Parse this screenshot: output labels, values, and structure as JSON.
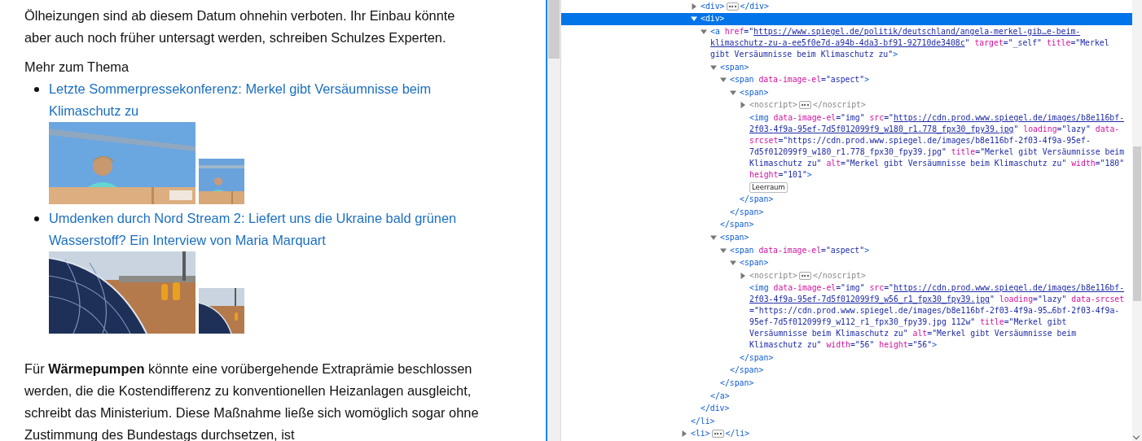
{
  "article": {
    "paragraphs_top": [
      "Ölheizungen sind ab diesem Datum ohnehin verboten. Ihr Einbau könnte aber auch noch früher untersagt werden, schreiben Schulzes Experten."
    ],
    "related": {
      "heading": "Mehr zum Thema",
      "items": [
        {
          "title": "Letzte Sommerpressekonferenz: Merkel gibt Versäumnisse beim Klimaschutz zu"
        },
        {
          "title": "Umdenken durch Nord Stream 2: Liefert uns die Ukraine bald grünen Wasserstoff? Ein Interview von Maria Marquart"
        }
      ]
    },
    "paragraphs_bottom": [
      "Für **Wärmepumpen** könnte eine vorübergehende Extraprämie beschlossen werden, die die Kostendifferenz zu konventionellen Heizanlagen ausgleicht, schreibt das Ministerium. Diese Maßnahme ließe sich womöglich sogar ohne Zustimmung des Bundestags durchsetzen, ist"
    ]
  },
  "inspector": {
    "tree": [
      {
        "kind": "element",
        "expanded": true,
        "selected": false,
        "close": [
          {
            "kind": "tag",
            "text": "</li>"
          }
        ],
        "children": [
          {
            "kind": "element",
            "expanded": false,
            "selected": false,
            "open": [
              {
                "kind": "tag",
                "text": "<div>"
              }
            ],
            "close": [
              {
                "kind": "tag",
                "text": "</div>"
              }
            ]
          },
          {
            "kind": "element",
            "expanded": true,
            "selected": true,
            "open": [
              {
                "kind": "tag",
                "text": "<div>"
              }
            ],
            "close": [
              {
                "kind": "tag",
                "text": "</div>"
              }
            ],
            "children": [
              {
                "kind": "element",
                "expanded": true,
                "selected": false,
                "open": [
                  {
                    "kind": "tag",
                    "text": "<a"
                  },
                  {
                    "kind": "attr",
                    "text": " href"
                  },
                  {
                    "kind": "value",
                    "text": "=\""
                  },
                  {
                    "kind": "link",
                    "text": "https://www.spiegel.de/politik/deutschland/angela-merkel-gib…e-beim-klimaschutz-zu-a-ee5f0e7d-a94b-4da3-bf91-92710de3408c"
                  },
                  {
                    "kind": "value",
                    "text": "\""
                  },
                  {
                    "kind": "attr",
                    "text": " target"
                  },
                  {
                    "kind": "value",
                    "text": "=\"_self\""
                  },
                  {
                    "kind": "attr",
                    "text": " title"
                  },
                  {
                    "kind": "value",
                    "text": "=\"Merkel gibt Versäumnisse beim Klimaschutz zu\""
                  },
                  {
                    "kind": "tag",
                    "text": ">"
                  }
                ],
                "close": [
                  {
                    "kind": "tag",
                    "text": "</a>"
                  }
                ],
                "children": [
                  {
                    "kind": "element",
                    "expanded": true,
                    "selected": false,
                    "open": [
                      {
                        "kind": "tag",
                        "text": "<span>"
                      }
                    ],
                    "close": [
                      {
                        "kind": "tag",
                        "text": "</span>"
                      }
                    ],
                    "children": [
                      {
                        "kind": "element",
                        "expanded": true,
                        "selected": false,
                        "open": [
                          {
                            "kind": "tag",
                            "text": "<span"
                          },
                          {
                            "kind": "attr",
                            "text": " data-image-el"
                          },
                          {
                            "kind": "value",
                            "text": "=\"aspect\""
                          },
                          {
                            "kind": "tag",
                            "text": ">"
                          }
                        ],
                        "close": [
                          {
                            "kind": "tag",
                            "text": "</span>"
                          }
                        ],
                        "children": [
                          {
                            "kind": "element",
                            "expanded": true,
                            "selected": false,
                            "open": [
                              {
                                "kind": "tag",
                                "text": "<span>"
                              }
                            ],
                            "close": [
                              {
                                "kind": "tag",
                                "text": "</span>"
                              }
                            ],
                            "children": [
                              {
                                "kind": "element",
                                "expanded": false,
                                "selected": false,
                                "open": [
                                  {
                                    "kind": "dim",
                                    "text": "<noscript>"
                                  }
                                ],
                                "close": [
                                  {
                                    "kind": "dim",
                                    "text": "</noscript>"
                                  }
                                ]
                              },
                              {
                                "kind": "leaf",
                                "selected": false,
                                "open": [
                                  {
                                    "kind": "tag",
                                    "text": "<img"
                                  },
                                  {
                                    "kind": "attr",
                                    "text": " data-image-el"
                                  },
                                  {
                                    "kind": "value",
                                    "text": "=\"img\""
                                  },
                                  {
                                    "kind": "attr",
                                    "text": " src"
                                  },
                                  {
                                    "kind": "value",
                                    "text": "=\""
                                  },
                                  {
                                    "kind": "link",
                                    "text": "https://cdn.prod.www.spiegel.de/images/b8e116bf-2f03-4f9a-95ef-7d5f012099f9_w180_r1.778_fpx30_fpy39.jpg"
                                  },
                                  {
                                    "kind": "value",
                                    "text": "\""
                                  },
                                  {
                                    "kind": "attr",
                                    "text": " loading"
                                  },
                                  {
                                    "kind": "value",
                                    "text": "=\"lazy\""
                                  },
                                  {
                                    "kind": "attr",
                                    "text": " data-srcset"
                                  },
                                  {
                                    "kind": "value",
                                    "text": "=\"https://cdn.prod.www.spiegel.de/images/b8e116bf-2f03-4f9a-95ef-7d5f012099f9_w180_r1.778_fpx30_fpy39.jpg\""
                                  },
                                  {
                                    "kind": "attr",
                                    "text": " title"
                                  },
                                  {
                                    "kind": "value",
                                    "text": "=\"Merkel gibt Versäumnisse beim Klimaschutz zu\""
                                  },
                                  {
                                    "kind": "attr",
                                    "text": " alt"
                                  },
                                  {
                                    "kind": "value",
                                    "text": "=\"Merkel gibt Versäumnisse beim Klimaschutz zu\""
                                  },
                                  {
                                    "kind": "attr",
                                    "text": " width"
                                  },
                                  {
                                    "kind": "value",
                                    "text": "=\"180\""
                                  },
                                  {
                                    "kind": "attr",
                                    "text": " height"
                                  },
                                  {
                                    "kind": "value",
                                    "text": "=\"101\""
                                  },
                                  {
                                    "kind": "tag",
                                    "text": ">"
                                  }
                                ]
                              },
                              {
                                "kind": "whitespace",
                                "selected": false,
                                "label": "Leerraum"
                              }
                            ]
                          }
                        ]
                      }
                    ]
                  },
                  {
                    "kind": "element",
                    "expanded": true,
                    "selected": false,
                    "open": [
                      {
                        "kind": "tag",
                        "text": "<span>"
                      }
                    ],
                    "close": [
                      {
                        "kind": "tag",
                        "text": "</span>"
                      }
                    ],
                    "children": [
                      {
                        "kind": "element",
                        "expanded": true,
                        "selected": false,
                        "open": [
                          {
                            "kind": "tag",
                            "text": "<span"
                          },
                          {
                            "kind": "attr",
                            "text": " data-image-el"
                          },
                          {
                            "kind": "value",
                            "text": "=\"aspect\""
                          },
                          {
                            "kind": "tag",
                            "text": ">"
                          }
                        ],
                        "close": [
                          {
                            "kind": "tag",
                            "text": "</span>"
                          }
                        ],
                        "children": [
                          {
                            "kind": "element",
                            "expanded": true,
                            "selected": false,
                            "open": [
                              {
                                "kind": "tag",
                                "text": "<span>"
                              }
                            ],
                            "close": [
                              {
                                "kind": "tag",
                                "text": "</span>"
                              }
                            ],
                            "children": [
                              {
                                "kind": "element",
                                "expanded": false,
                                "selected": false,
                                "open": [
                                  {
                                    "kind": "dim",
                                    "text": "<noscript>"
                                  }
                                ],
                                "close": [
                                  {
                                    "kind": "dim",
                                    "text": "</noscript>"
                                  }
                                ]
                              },
                              {
                                "kind": "leaf",
                                "selected": false,
                                "open": [
                                  {
                                    "kind": "tag",
                                    "text": "<img"
                                  },
                                  {
                                    "kind": "attr",
                                    "text": " data-image-el"
                                  },
                                  {
                                    "kind": "value",
                                    "text": "=\"img\""
                                  },
                                  {
                                    "kind": "attr",
                                    "text": " src"
                                  },
                                  {
                                    "kind": "value",
                                    "text": "=\""
                                  },
                                  {
                                    "kind": "link",
                                    "text": "https://cdn.prod.www.spiegel.de/images/b8e116bf-2f03-4f9a-95ef-7d5f012099f9_w56_r1_fpx30_fpy39.jpg"
                                  },
                                  {
                                    "kind": "value",
                                    "text": "\""
                                  },
                                  {
                                    "kind": "attr",
                                    "text": " loading"
                                  },
                                  {
                                    "kind": "value",
                                    "text": "=\"lazy\""
                                  },
                                  {
                                    "kind": "attr",
                                    "text": " data-srcset"
                                  },
                                  {
                                    "kind": "value",
                                    "text": "=\"https://cdn.prod.www.spiegel.de/images/b8e116bf-2f03-4f9a-95…6bf-2f03-4f9a-95ef-7d5f012099f9_w112_r1_fpx30_fpy39.jpg 112w\""
                                  },
                                  {
                                    "kind": "attr",
                                    "text": " title"
                                  },
                                  {
                                    "kind": "value",
                                    "text": "=\"Merkel gibt Versäumnisse beim Klimaschutz zu\""
                                  },
                                  {
                                    "kind": "attr",
                                    "text": " alt"
                                  },
                                  {
                                    "kind": "value",
                                    "text": "=\"Merkel gibt Versäumnisse beim Klimaschutz zu\""
                                  },
                                  {
                                    "kind": "attr",
                                    "text": " width"
                                  },
                                  {
                                    "kind": "value",
                                    "text": "=\"56\""
                                  },
                                  {
                                    "kind": "attr",
                                    "text": " height"
                                  },
                                  {
                                    "kind": "value",
                                    "text": "=\"56\""
                                  },
                                  {
                                    "kind": "tag",
                                    "text": ">"
                                  }
                                ]
                              }
                            ]
                          }
                        ]
                      }
                    ]
                  }
                ]
              }
            ]
          }
        ]
      },
      {
        "kind": "element",
        "expanded": false,
        "selected": false,
        "open": [
          {
            "kind": "tag",
            "text": "<li>"
          }
        ],
        "close": [
          {
            "kind": "tag",
            "text": "</li>"
          }
        ]
      }
    ]
  }
}
